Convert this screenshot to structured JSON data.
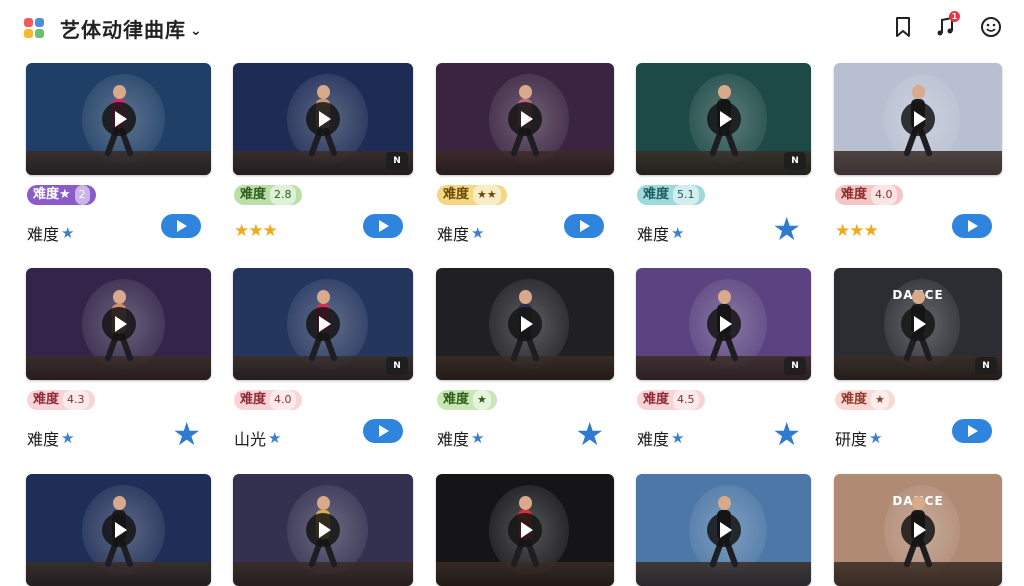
{
  "app": {
    "title": "艺体动律曲库",
    "logo_icon": "app-grid-icon",
    "dropdown_icon": "chevron-down-icon"
  },
  "toolbar": {
    "bookmark_icon": "bookmark-icon",
    "music_icon": "music-note-icon",
    "music_badge": "1",
    "profile_icon": "smiley-icon"
  },
  "colors": {
    "accent": "#2f84dd",
    "star": "#f0a91c",
    "badge": "#ef3340"
  },
  "rows": [
    {
      "cards": [
        {
          "thumb_bg": "#1f3f66",
          "costume": "#d12a6b",
          "mini": "",
          "poster": "",
          "pill_label": "难度★",
          "pill_value": "2",
          "pill_bg": "#8a5cc9",
          "pill_fg": "#ffffff",
          "meta_label": "难度",
          "meta_stars": "",
          "meta_star_mini": "★",
          "action": "play"
        },
        {
          "thumb_bg": "#1e2c55",
          "costume": "#cc9a72",
          "mini": "N",
          "poster": "",
          "pill_label": "难度",
          "pill_value": "2.8",
          "pill_bg": "#b9e0a8",
          "pill_fg": "#2e5c1f",
          "meta_label": "",
          "meta_stars": "★★★",
          "meta_star_mini": "",
          "action": "play"
        },
        {
          "thumb_bg": "#3a2440",
          "costume": "#c46a82",
          "mini": "",
          "poster": "",
          "pill_label": "难度",
          "pill_value": "★★",
          "pill_bg": "#f3d782",
          "pill_fg": "#6a4a08",
          "meta_label": "难度",
          "meta_stars": "",
          "meta_star_mini": "★",
          "action": "play"
        },
        {
          "thumb_bg": "#1d4a47",
          "costume": "#181818",
          "mini": "N",
          "poster": "",
          "pill_label": "难度",
          "pill_value": "5.1",
          "pill_bg": "#9fd9dc",
          "pill_fg": "#1c5d61",
          "meta_label": "难度",
          "meta_stars": "",
          "meta_star_mini": "★",
          "action": "star"
        },
        {
          "thumb_bg": "#b7bfd0",
          "costume": "#1b1b26",
          "mini": "",
          "poster": "",
          "pill_label": "难度",
          "pill_value": "4.0",
          "pill_bg": "#f4c6c6",
          "pill_fg": "#8c2b2b",
          "meta_label": "",
          "meta_stars": "★★★",
          "meta_star_mini": "",
          "action": "play"
        }
      ]
    },
    {
      "cards": [
        {
          "thumb_bg": "#33254a",
          "costume": "#c98e6e",
          "mini": "",
          "poster": "",
          "pill_label": "难度",
          "pill_value": "4.3",
          "pill_bg": "#f9d3d6",
          "pill_fg": "#8c2b36",
          "meta_label": "难度",
          "meta_stars": "",
          "meta_star_mini": "★",
          "action": "star"
        },
        {
          "thumb_bg": "#24355e",
          "costume": "#cf2d5a",
          "mini": "N",
          "poster": "",
          "pill_label": "难度",
          "pill_value": "4.0",
          "pill_bg": "#f9d3d6",
          "pill_fg": "#8c2b36",
          "meta_label": "山光",
          "meta_stars": "",
          "meta_star_mini": "★",
          "action": "play"
        },
        {
          "thumb_bg": "#1f1f24",
          "costume": "#2a2e4a",
          "mini": "",
          "poster": "",
          "pill_label": "难度",
          "pill_value": "★",
          "pill_bg": "#c7e8b2",
          "pill_fg": "#2d5c1c",
          "meta_label": "难度",
          "meta_stars": "",
          "meta_star_mini": "★",
          "action": "star"
        },
        {
          "thumb_bg": "#5a4380",
          "costume": "#151515",
          "mini": "N",
          "poster": "",
          "pill_label": "难度",
          "pill_value": "4.5",
          "pill_bg": "#f9d3d6",
          "pill_fg": "#8c2b36",
          "meta_label": "难度",
          "meta_stars": "",
          "meta_star_mini": "★",
          "action": "star"
        },
        {
          "thumb_bg": "#2b2d33",
          "costume": "#1a1a1a",
          "mini": "N",
          "poster": "DANCE",
          "pill_label": "难度",
          "pill_value": "★",
          "pill_bg": "#fbd9d3",
          "pill_fg": "#8c3b2b",
          "meta_label": "研度",
          "meta_stars": "",
          "meta_star_mini": "★",
          "action": "play"
        }
      ]
    },
    {
      "cards": [
        {
          "thumb_bg": "#1e2e57",
          "costume": "#1d1d22",
          "mini": "",
          "poster": "",
          "pill_label": "",
          "pill_value": "",
          "pill_bg": "",
          "pill_fg": "",
          "meta_label": "",
          "meta_stars": "",
          "meta_star_mini": "",
          "action": ""
        },
        {
          "thumb_bg": "#333050",
          "costume": "#d7b34a",
          "mini": "",
          "poster": "",
          "pill_label": "",
          "pill_value": "",
          "pill_bg": "",
          "pill_fg": "",
          "meta_label": "",
          "meta_stars": "",
          "meta_star_mini": "",
          "action": ""
        },
        {
          "thumb_bg": "#151518",
          "costume": "#d8303a",
          "mini": "",
          "poster": "",
          "pill_label": "",
          "pill_value": "",
          "pill_bg": "",
          "pill_fg": "",
          "meta_label": "",
          "meta_stars": "",
          "meta_star_mini": "",
          "action": ""
        },
        {
          "thumb_bg": "#4c77a6",
          "costume": "#161616",
          "mini": "",
          "poster": "",
          "pill_label": "",
          "pill_value": "",
          "pill_bg": "",
          "pill_fg": "",
          "meta_label": "",
          "meta_stars": "",
          "meta_star_mini": "",
          "action": ""
        },
        {
          "thumb_bg": "#b08a73",
          "costume": "#1a1a1a",
          "mini": "",
          "poster": "DANCE",
          "pill_label": "",
          "pill_value": "",
          "pill_bg": "",
          "pill_fg": "",
          "meta_label": "",
          "meta_stars": "",
          "meta_star_mini": "",
          "action": ""
        }
      ]
    }
  ]
}
